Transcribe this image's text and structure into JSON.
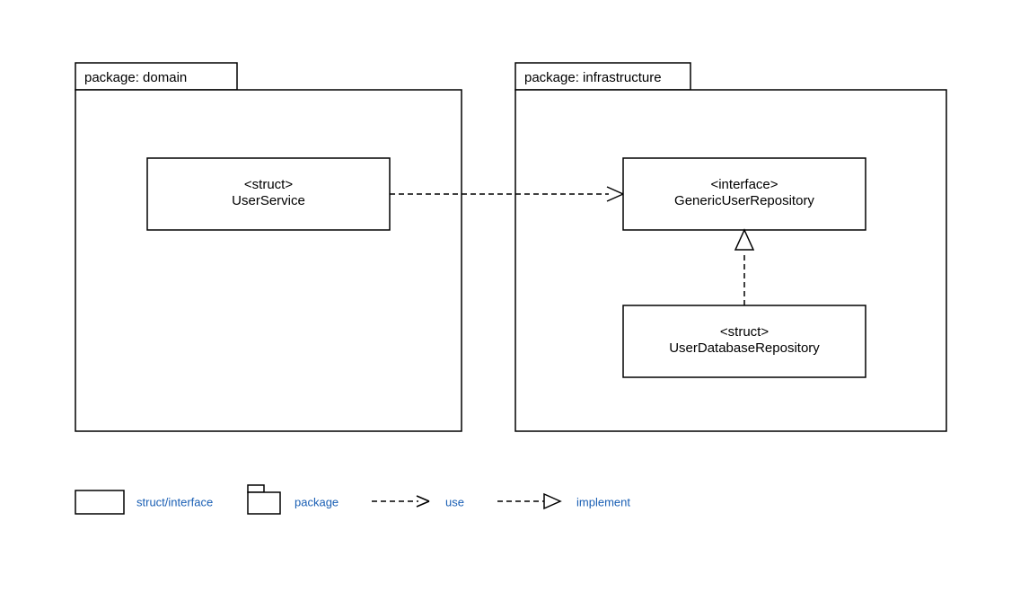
{
  "packages": {
    "domain": {
      "label": "package: domain"
    },
    "infrastructure": {
      "label": "package: infrastructure"
    }
  },
  "nodes": {
    "user_service": {
      "stereotype": "<struct>",
      "name": "UserService"
    },
    "generic_user_repository": {
      "stereotype": "<interface>",
      "name": "GenericUserRepository"
    },
    "user_database_repository": {
      "stereotype": "<struct>",
      "name": "UserDatabaseRepository"
    }
  },
  "legend": {
    "struct_interface": "struct/interface",
    "package": "package",
    "use": "use",
    "implement": "implement"
  }
}
